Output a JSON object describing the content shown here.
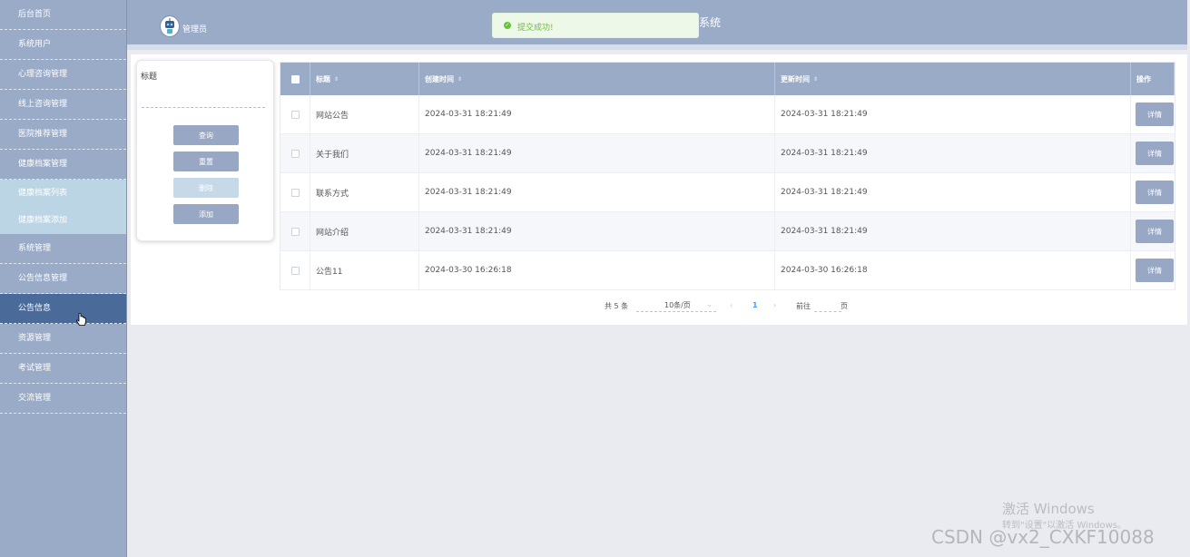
{
  "sidebar": {
    "items": [
      {
        "label": "后台首页"
      },
      {
        "label": "系统用户"
      },
      {
        "label": "心理咨询管理"
      },
      {
        "label": "线上咨询管理"
      },
      {
        "label": "医院推荐管理"
      },
      {
        "label": "健康档案管理"
      }
    ],
    "subitems": [
      {
        "label": "健康档案列表"
      },
      {
        "label": "健康档案添加"
      }
    ],
    "items_after": [
      {
        "label": "系统管理"
      },
      {
        "label": "公告信息管理"
      },
      {
        "label": "公告信息"
      },
      {
        "label": "资源管理"
      },
      {
        "label": "考试管理"
      },
      {
        "label": "交流管理"
      }
    ]
  },
  "header": {
    "admin_label": "管理员",
    "title_visible": "系统"
  },
  "toast": {
    "message": "提交成功!",
    "icon": "check-circle-icon",
    "color": "#67c23a"
  },
  "search": {
    "label": "标题",
    "value": "",
    "buttons": {
      "query": "查询",
      "reset": "重置",
      "delete": "删除",
      "add": "添加"
    }
  },
  "table": {
    "headers": {
      "title": "标题",
      "created": "创建时间",
      "updated": "更新时间",
      "actions": "操作"
    },
    "rows": [
      {
        "title": "网站公告",
        "created": "2024-03-31 18:21:49",
        "updated": "2024-03-31 18:21:49",
        "action": "详情"
      },
      {
        "title": "关于我们",
        "created": "2024-03-31 18:21:49",
        "updated": "2024-03-31 18:21:49",
        "action": "详情"
      },
      {
        "title": "联系方式",
        "created": "2024-03-31 18:21:49",
        "updated": "2024-03-31 18:21:49",
        "action": "详情"
      },
      {
        "title": "网站介绍",
        "created": "2024-03-31 18:21:49",
        "updated": "2024-03-31 18:21:49",
        "action": "详情"
      },
      {
        "title": "公告11",
        "created": "2024-03-30 16:26:18",
        "updated": "2024-03-30 16:26:18",
        "action": "详情"
      }
    ]
  },
  "pagination": {
    "total": "共 5 条",
    "page_size": "10条/页",
    "prev": "‹",
    "current": "1",
    "next": "›",
    "goto": "前往",
    "page": "页"
  },
  "watermark": {
    "win_title": "激活 Windows",
    "win_sub": "转到\"设置\"以激活 Windows。",
    "csdn": "CSDN @vx2_CXKF10088"
  },
  "colors": {
    "sidebar_bg": "#9aabc7",
    "active_item": "#4a6b9a",
    "sub_bg": "#bcd5e4",
    "button": "#98a8c4",
    "page_active": "#409eff"
  }
}
